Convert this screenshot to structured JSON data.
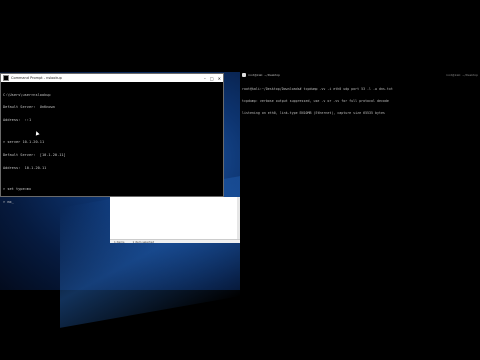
{
  "cmd": {
    "title": "Command Prompt - nslookup",
    "controls": {
      "minimize": "–",
      "maximize": "□",
      "close": "✕"
    },
    "lines": [
      "C:\\Users\\user>nslookup",
      "Default Server:  UnKnown",
      "Address:  ::1",
      "",
      "> server 10.1.20.11",
      "Default Server:  [10.1.20.11]",
      "Address:  10.1.20.11",
      "",
      "> set type=mx",
      "> mx_"
    ]
  },
  "white_panel": {
    "status_items": [
      "1 items",
      "1 item selected"
    ]
  },
  "terminal": {
    "title": "root@kali: ~/Desktop",
    "top_right": "root@kali: ~/Desktop",
    "lines": [
      "root@kali:~/Desktop/Downloads# tcpdump -vv -i eth0 udp port 53 -l -w dns.txt",
      "tcpdump: verbose output suppressed, use -v or -vv for full protocol decode",
      "listening on eth0, link-type EN10MB (Ethernet), capture size 65535 bytes"
    ]
  }
}
